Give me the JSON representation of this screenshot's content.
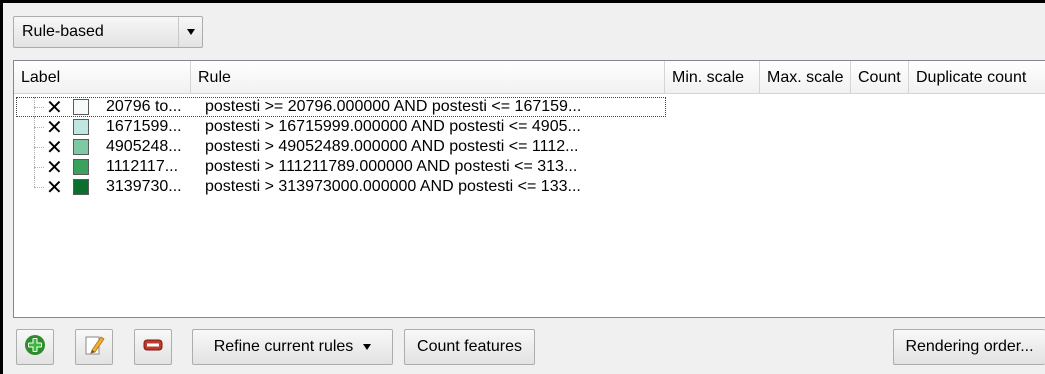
{
  "renderer": {
    "selected": "Rule-based"
  },
  "tree": {
    "columns": [
      "Label",
      "Rule",
      "Min. scale",
      "Max. scale",
      "Count",
      "Duplicate count"
    ],
    "rows": [
      {
        "checked": "✕",
        "color": "#f7fcfb",
        "label": "20796 to...",
        "rule": "postesti >= 20796.000000 AND postesti <= 167159..."
      },
      {
        "checked": "✕",
        "color": "#bfe6df",
        "label": "1671599...",
        "rule": "postesti > 16715999.000000 AND postesti <= 4905..."
      },
      {
        "checked": "✕",
        "color": "#7fc8a4",
        "label": "4905248...",
        "rule": "postesti > 49052489.000000 AND postesti <= 1112..."
      },
      {
        "checked": "✕",
        "color": "#3aa25c",
        "label": "1112117...",
        "rule": "postesti > 111211789.000000 AND postesti <= 313..."
      },
      {
        "checked": "✕",
        "color": "#0a6e2c",
        "label": "3139730...",
        "rule": "postesti > 313973000.000000 AND postesti <= 133..."
      }
    ]
  },
  "toolbar": {
    "add_icon": "add-rule-icon",
    "edit_icon": "edit-rule-icon",
    "remove_icon": "remove-rule-icon",
    "refine_label": "Refine current rules",
    "count_label": "Count features",
    "rendering_order_label": "Rendering order..."
  }
}
